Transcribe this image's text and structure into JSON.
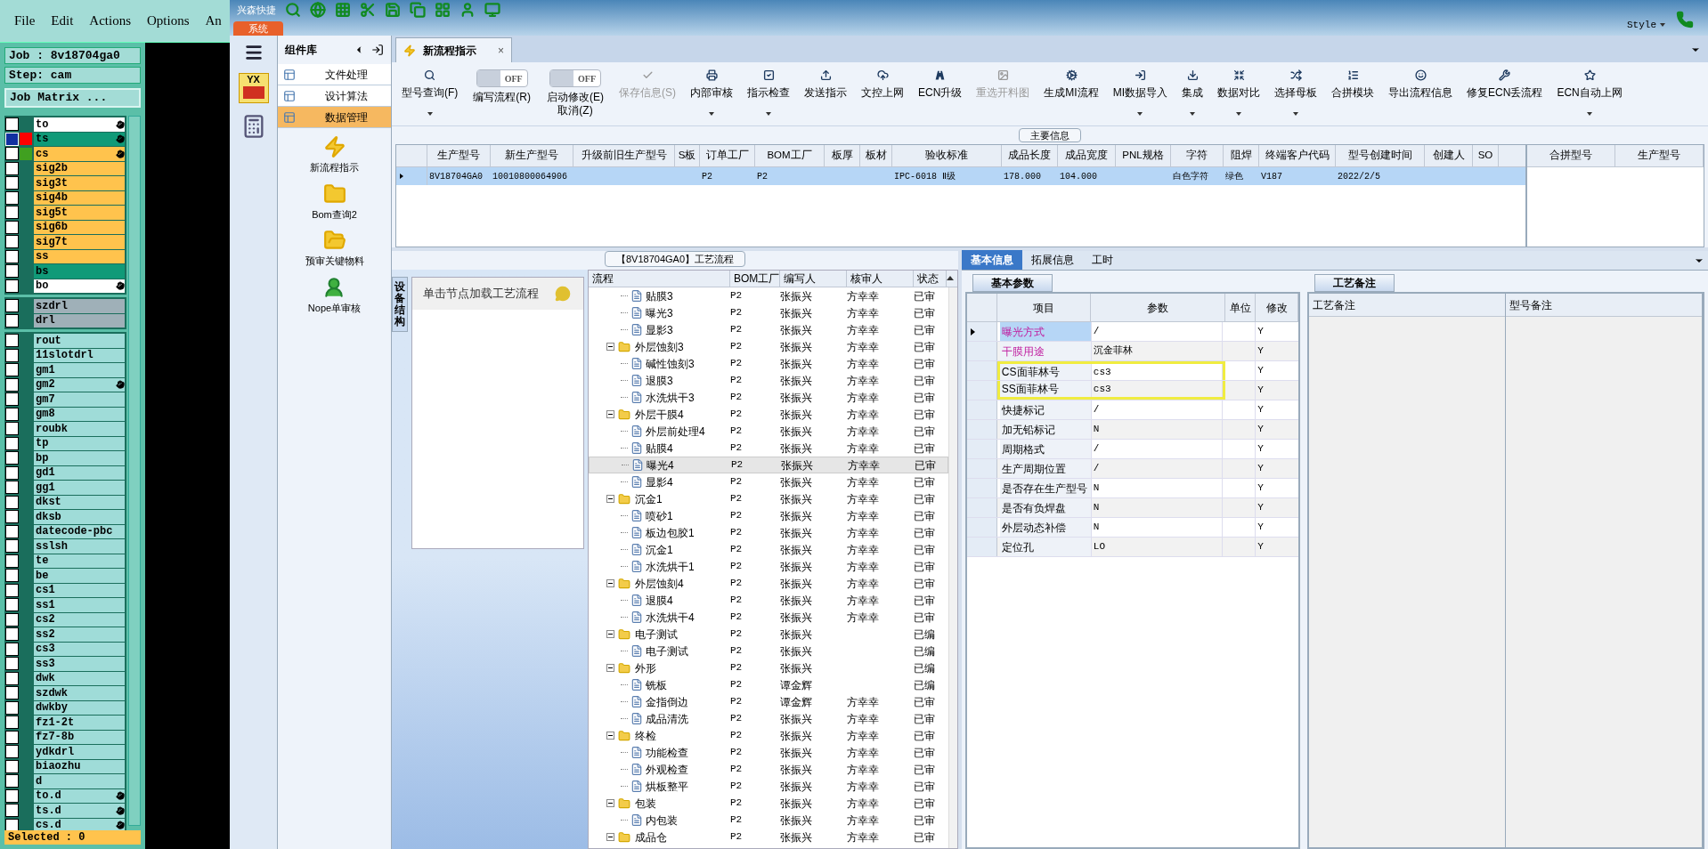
{
  "genesis": {
    "menu": [
      "File",
      "Edit",
      "Actions",
      "Options",
      "An"
    ],
    "job": "Job : 8v18704ga0",
    "step": "Step: cam",
    "matrix_button": "Job Matrix ...",
    "layer_groups": [
      {
        "layers": [
          {
            "name": "to",
            "color": "#ffffff",
            "affected": true,
            "work": false
          },
          {
            "name": "ts",
            "color": "#109a78",
            "affected": true,
            "work": true,
            "tag": {
              "color": "#ff0000"
            }
          },
          {
            "name": "cs",
            "color": "#ffc34d",
            "affected": true,
            "work": false,
            "tag": {
              "color": "#40a020"
            }
          },
          {
            "name": "sig2b",
            "color": "#ffc34d",
            "affected": false,
            "work": false
          },
          {
            "name": "sig3t",
            "color": "#ffc34d",
            "affected": false,
            "work": false
          },
          {
            "name": "sig4b",
            "color": "#ffc34d",
            "affected": false,
            "work": false
          },
          {
            "name": "sig5t",
            "color": "#ffc34d",
            "affected": false,
            "work": false
          },
          {
            "name": "sig6b",
            "color": "#ffc34d",
            "affected": false,
            "work": false
          },
          {
            "name": "sig7t",
            "color": "#ffc34d",
            "affected": false,
            "work": false
          },
          {
            "name": "ss",
            "color": "#ffc34d",
            "affected": false,
            "work": false
          },
          {
            "name": "bs",
            "color": "#109a78",
            "affected": false,
            "work": false
          },
          {
            "name": "bo",
            "color": "#ffffff",
            "affected": true,
            "work": false
          }
        ]
      },
      {
        "layers": [
          {
            "name": "szdrl",
            "color": "#9fb0b8",
            "affected": false,
            "work": false
          },
          {
            "name": "drl",
            "color": "#9fb0b8",
            "affected": false,
            "work": false
          }
        ]
      },
      {
        "layers": [
          {
            "name": "rout",
            "color": "#9fdcd8",
            "affected": false,
            "work": false
          },
          {
            "name": "11slotdrl",
            "color": "#9fdcd8",
            "affected": false,
            "work": false
          },
          {
            "name": "gm1",
            "color": "#9fdcd8",
            "affected": false,
            "work": false
          },
          {
            "name": "gm2",
            "color": "#9fdcd8",
            "affected": true,
            "work": false
          },
          {
            "name": "gm7",
            "color": "#9fdcd8",
            "affected": false,
            "work": false
          },
          {
            "name": "gm8",
            "color": "#9fdcd8",
            "affected": false,
            "work": false
          },
          {
            "name": "roubk",
            "color": "#9fdcd8",
            "affected": false,
            "work": false
          },
          {
            "name": "tp",
            "color": "#9fdcd8",
            "affected": false,
            "work": false
          },
          {
            "name": "bp",
            "color": "#9fdcd8",
            "affected": false,
            "work": false
          },
          {
            "name": "gd1",
            "color": "#9fdcd8",
            "affected": false,
            "work": false
          },
          {
            "name": "gg1",
            "color": "#9fdcd8",
            "affected": false,
            "work": false
          },
          {
            "name": "dkst",
            "color": "#9fdcd8",
            "affected": false,
            "work": false
          },
          {
            "name": "dksb",
            "color": "#9fdcd8",
            "affected": false,
            "work": false
          },
          {
            "name": "datecode-pbc",
            "color": "#9fdcd8",
            "affected": false,
            "work": false
          },
          {
            "name": "sslsh",
            "color": "#9fdcd8",
            "affected": false,
            "work": false
          },
          {
            "name": "te",
            "color": "#9fdcd8",
            "affected": false,
            "work": false
          },
          {
            "name": "be",
            "color": "#9fdcd8",
            "affected": false,
            "work": false
          },
          {
            "name": "cs1",
            "color": "#9fdcd8",
            "affected": false,
            "work": false
          },
          {
            "name": "ss1",
            "color": "#9fdcd8",
            "affected": false,
            "work": false
          },
          {
            "name": "cs2",
            "color": "#9fdcd8",
            "affected": false,
            "work": false
          },
          {
            "name": "ss2",
            "color": "#9fdcd8",
            "affected": false,
            "work": false
          },
          {
            "name": "cs3",
            "color": "#9fdcd8",
            "affected": false,
            "work": false
          },
          {
            "name": "ss3",
            "color": "#9fdcd8",
            "affected": false,
            "work": false
          },
          {
            "name": "dwk",
            "color": "#9fdcd8",
            "affected": false,
            "work": false
          },
          {
            "name": "szdwk",
            "color": "#9fdcd8",
            "affected": false,
            "work": false
          },
          {
            "name": "dwkby",
            "color": "#9fdcd8",
            "affected": false,
            "work": false
          },
          {
            "name": "fz1-2t",
            "color": "#9fdcd8",
            "affected": false,
            "work": false
          },
          {
            "name": "fz7-8b",
            "color": "#9fdcd8",
            "affected": false,
            "work": false
          },
          {
            "name": "ydkdrl",
            "color": "#9fdcd8",
            "affected": false,
            "work": false
          },
          {
            "name": "biaozhu",
            "color": "#9fdcd8",
            "affected": false,
            "work": false
          },
          {
            "name": "d",
            "color": "#9fdcd8",
            "affected": false,
            "work": false
          },
          {
            "name": "to.d",
            "color": "#9fdcd8",
            "affected": true,
            "work": false
          },
          {
            "name": "ts.d",
            "color": "#9fdcd8",
            "affected": true,
            "work": false
          },
          {
            "name": "cs.d",
            "color": "#9fdcd8",
            "affected": true,
            "work": false
          }
        ]
      }
    ],
    "selected_count": "Selected : 0"
  },
  "app": {
    "title": "兴森快捷",
    "system_tab": "系统",
    "style_menu": "Style",
    "nav": {
      "title": "组件库",
      "items": [
        {
          "label": "文件处理",
          "selected": false
        },
        {
          "label": "设计算法",
          "selected": false
        },
        {
          "label": "数据管理",
          "selected": true
        }
      ],
      "logo_text": "YX",
      "launchers": [
        "新流程指示",
        "Bom查询2",
        "预审关键物料",
        "Nope单审核"
      ]
    },
    "doc_tab": {
      "label": "新流程指示",
      "close": "×"
    },
    "ribbon": [
      {
        "kind": "button",
        "label": "型号查询(F)",
        "dropdown": true,
        "disabled": false
      },
      {
        "kind": "toggle",
        "label": "编写流程(R)",
        "state": "OFF",
        "on": false
      },
      {
        "kind": "toggle",
        "label": "启动修改(E)",
        "label2": "取消(Z)",
        "state": "OFF",
        "on": false
      },
      {
        "kind": "button",
        "label": "保存信息(S)",
        "dropdown": false,
        "disabled": true
      },
      {
        "kind": "button",
        "label": "内部审核",
        "dropdown": true,
        "disabled": false
      },
      {
        "kind": "button",
        "label": "指示检查",
        "dropdown": true,
        "disabled": false
      },
      {
        "kind": "button",
        "label": "发送指示",
        "dropdown": false,
        "disabled": false
      },
      {
        "kind": "button",
        "label": "文控上网",
        "dropdown": false,
        "disabled": false
      },
      {
        "kind": "button",
        "label": "ECN升级",
        "dropdown": false,
        "disabled": false
      },
      {
        "kind": "button",
        "label": "重选开料图",
        "dropdown": false,
        "disabled": true
      },
      {
        "kind": "button",
        "label": "生成MI流程",
        "dropdown": false,
        "disabled": false
      },
      {
        "kind": "button",
        "label": "MI数据导入",
        "dropdown": true,
        "disabled": false
      },
      {
        "kind": "button",
        "label": "集成",
        "dropdown": true,
        "disabled": false
      },
      {
        "kind": "button",
        "label": "数据对比",
        "dropdown": true,
        "disabled": false
      },
      {
        "kind": "button",
        "label": "选择母板",
        "dropdown": true,
        "disabled": false
      },
      {
        "kind": "button",
        "label": "合拼模块",
        "dropdown": false,
        "disabled": false
      },
      {
        "kind": "button",
        "label": "导出流程信息",
        "dropdown": false,
        "disabled": false
      },
      {
        "kind": "button",
        "label": "修复ECN丢流程",
        "dropdown": false,
        "disabled": false
      },
      {
        "kind": "button",
        "label": "ECN自动上网",
        "dropdown": true,
        "disabled": false
      }
    ],
    "main_info": {
      "title": "主要信息",
      "row_selected": true,
      "columns": [
        {
          "label": "生产型号",
          "value": "8V18704GA0"
        },
        {
          "label": "新生产型号",
          "value": "10010800064906"
        },
        {
          "label": "升级前旧生产型号"
        },
        {
          "label": "S板"
        },
        {
          "label": "订单工厂",
          "value": "P2"
        },
        {
          "label": "BOM工厂",
          "value": "P2"
        },
        {
          "label": "板厚"
        },
        {
          "label": "板材"
        },
        {
          "label": "验收标准",
          "value": "IPC-6018 Ⅱ级"
        },
        {
          "label": "成品长度",
          "value": "178.000"
        },
        {
          "label": "成品宽度",
          "value": "104.000"
        },
        {
          "label": "PNL规格"
        },
        {
          "label": "字符",
          "value": "白色字符"
        },
        {
          "label": "阻焊",
          "value": "绿色"
        },
        {
          "label": "终端客户代码",
          "value": "V187"
        },
        {
          "label": "型号创建时间",
          "value": "2022/2/5"
        },
        {
          "label": "创建人"
        },
        {
          "label": "SO"
        }
      ],
      "merge_columns": [
        "合拼型号",
        "生产型号"
      ]
    },
    "process": {
      "title": "【8V18704GA0】工艺流程",
      "side_tab": "设备结构",
      "hint": "单击节点加载工艺流程",
      "columns": [
        "流程",
        "BOM工厂",
        "编写人",
        "核审人",
        "状态"
      ],
      "continued_children": [
        {
          "name": "贴膜3",
          "bom": "P2",
          "writer": "张振兴",
          "reviewer": "方幸幸",
          "status": "已审",
          "selected": false
        },
        {
          "name": "曝光3",
          "bom": "P2",
          "writer": "张振兴",
          "reviewer": "方幸幸",
          "status": "已审",
          "selected": false
        },
        {
          "name": "显影3",
          "bom": "P2",
          "writer": "张振兴",
          "reviewer": "方幸幸",
          "status": "已审",
          "selected": false
        }
      ],
      "nodes": [
        {
          "name": "外层蚀刻3",
          "bom": "P2",
          "writer": "张振兴",
          "reviewer": "方幸幸",
          "status": "已审",
          "selected": false,
          "expanded": true,
          "children": [
            {
              "name": "碱性蚀刻3",
              "bom": "P2",
              "writer": "张振兴",
              "reviewer": "方幸幸",
              "status": "已审",
              "selected": false
            },
            {
              "name": "退膜3",
              "bom": "P2",
              "writer": "张振兴",
              "reviewer": "方幸幸",
              "status": "已审",
              "selected": false
            },
            {
              "name": "水洗烘干3",
              "bom": "P2",
              "writer": "张振兴",
              "reviewer": "方幸幸",
              "status": "已审",
              "selected": false
            }
          ]
        },
        {
          "name": "外层干膜4",
          "bom": "P2",
          "writer": "张振兴",
          "reviewer": "方幸幸",
          "status": "已审",
          "selected": false,
          "expanded": true,
          "children": [
            {
              "name": "外层前处理4",
              "bom": "P2",
              "writer": "张振兴",
              "reviewer": "方幸幸",
              "status": "已审",
              "selected": false
            },
            {
              "name": "贴膜4",
              "bom": "P2",
              "writer": "张振兴",
              "reviewer": "方幸幸",
              "status": "已审",
              "selected": false
            },
            {
              "name": "曝光4",
              "bom": "P2",
              "writer": "张振兴",
              "reviewer": "方幸幸",
              "status": "已审",
              "selected": true
            },
            {
              "name": "显影4",
              "bom": "P2",
              "writer": "张振兴",
              "reviewer": "方幸幸",
              "status": "已审",
              "selected": false
            }
          ]
        },
        {
          "name": "沉金1",
          "bom": "P2",
          "writer": "张振兴",
          "reviewer": "方幸幸",
          "status": "已审",
          "selected": false,
          "expanded": true,
          "children": [
            {
              "name": "喷砂1",
              "bom": "P2",
              "writer": "张振兴",
              "reviewer": "方幸幸",
              "status": "已审",
              "selected": false
            },
            {
              "name": "板边包胶1",
              "bom": "P2",
              "writer": "张振兴",
              "reviewer": "方幸幸",
              "status": "已审",
              "selected": false
            },
            {
              "name": "沉金1",
              "bom": "P2",
              "writer": "张振兴",
              "reviewer": "方幸幸",
              "status": "已审",
              "selected": false
            },
            {
              "name": "水洗烘干1",
              "bom": "P2",
              "writer": "张振兴",
              "reviewer": "方幸幸",
              "status": "已审",
              "selected": false
            }
          ]
        },
        {
          "name": "外层蚀刻4",
          "bom": "P2",
          "writer": "张振兴",
          "reviewer": "方幸幸",
          "status": "已审",
          "selected": false,
          "expanded": true,
          "children": [
            {
              "name": "退膜4",
              "bom": "P2",
              "writer": "张振兴",
              "reviewer": "方幸幸",
              "status": "已审",
              "selected": false
            },
            {
              "name": "水洗烘干4",
              "bom": "P2",
              "writer": "张振兴",
              "reviewer": "方幸幸",
              "status": "已审",
              "selected": false
            }
          ]
        },
        {
          "name": "电子测试",
          "bom": "P2",
          "writer": "张振兴",
          "status": "已编",
          "selected": false,
          "expanded": true,
          "children": [
            {
              "name": "电子测试",
              "bom": "P2",
              "writer": "张振兴",
              "status": "已编",
              "selected": false
            }
          ]
        },
        {
          "name": "外形",
          "bom": "P2",
          "writer": "张振兴",
          "status": "已编",
          "selected": false,
          "expanded": true,
          "children": [
            {
              "name": "铣板",
              "bom": "P2",
              "writer": "谭金辉",
              "status": "已编",
              "selected": false
            },
            {
              "name": "金指倒边",
              "bom": "P2",
              "writer": "谭金辉",
              "reviewer": "方幸幸",
              "status": "已审",
              "selected": false
            },
            {
              "name": "成品清洗",
              "bom": "P2",
              "writer": "张振兴",
              "reviewer": "方幸幸",
              "status": "已审",
              "selected": false
            }
          ]
        },
        {
          "name": "终检",
          "bom": "P2",
          "writer": "张振兴",
          "reviewer": "方幸幸",
          "status": "已审",
          "selected": false,
          "expanded": true,
          "children": [
            {
              "name": "功能检查",
              "bom": "P2",
              "writer": "张振兴",
              "reviewer": "方幸幸",
              "status": "已审",
              "selected": false
            },
            {
              "name": "外观检查",
              "bom": "P2",
              "writer": "张振兴",
              "reviewer": "方幸幸",
              "status": "已审",
              "selected": false
            },
            {
              "name": "烘板整平",
              "bom": "P2",
              "writer": "张振兴",
              "reviewer": "方幸幸",
              "status": "已审",
              "selected": false
            }
          ]
        },
        {
          "name": "包装",
          "bom": "P2",
          "writer": "张振兴",
          "reviewer": "方幸幸",
          "status": "已审",
          "selected": false,
          "expanded": true,
          "children": [
            {
              "name": "内包装",
              "bom": "P2",
              "writer": "张振兴",
              "reviewer": "方幸幸",
              "status": "已审",
              "selected": false
            }
          ]
        },
        {
          "name": "成品仓",
          "bom": "P2",
          "writer": "张振兴",
          "reviewer": "方幸幸",
          "status": "已审",
          "selected": false,
          "expanded": true
        }
      ]
    },
    "detail": {
      "tabs": [
        {
          "label": "基本信息",
          "selected": true
        },
        {
          "label": "拓展信息",
          "selected": false
        },
        {
          "label": "工时",
          "selected": false
        }
      ],
      "params_tab": "基本参数",
      "params_columns": [
        "项目",
        "参数",
        "单位",
        "修改"
      ],
      "params": [
        {
          "item": "曝光方式",
          "value": "/",
          "modify": "Y",
          "emphasized": true,
          "selected": true,
          "outlined": false
        },
        {
          "item": "干膜用途",
          "value": "沉金菲林",
          "modify": "Y",
          "emphasized": true,
          "selected": false,
          "outlined": false
        },
        {
          "item": "CS面菲林号",
          "value": "cs3",
          "modify": "Y",
          "emphasized": false,
          "selected": false,
          "outlined": true
        },
        {
          "item": "SS面菲林号",
          "value": "cs3",
          "modify": "Y",
          "emphasized": false,
          "selected": false,
          "outlined": true
        },
        {
          "item": "快捷标记",
          "value": "/",
          "modify": "Y",
          "emphasized": false,
          "selected": false,
          "outlined": false
        },
        {
          "item": "加无铅标记",
          "value": "N",
          "modify": "Y",
          "emphasized": false,
          "selected": false,
          "outlined": false
        },
        {
          "item": "周期格式",
          "value": "/",
          "modify": "Y",
          "emphasized": false,
          "selected": false,
          "outlined": false
        },
        {
          "item": "生产周期位置",
          "value": "/",
          "modify": "Y",
          "emphasized": false,
          "selected": false,
          "outlined": false
        },
        {
          "item": "是否存在生产型号",
          "value": "N",
          "modify": "Y",
          "emphasized": false,
          "selected": false,
          "outlined": false
        },
        {
          "item": "是否有负焊盘",
          "value": "N",
          "modify": "Y",
          "emphasized": false,
          "selected": false,
          "outlined": false
        },
        {
          "item": "外层动态补偿",
          "value": "N",
          "modify": "Y",
          "emphasized": false,
          "selected": false,
          "outlined": false
        },
        {
          "item": "定位孔",
          "value": "LO",
          "modify": "Y",
          "emphasized": false,
          "selected": false,
          "outlined": false
        }
      ],
      "notes_tab": "工艺备注",
      "notes_columns": [
        "工艺备注",
        "型号备注"
      ]
    }
  }
}
